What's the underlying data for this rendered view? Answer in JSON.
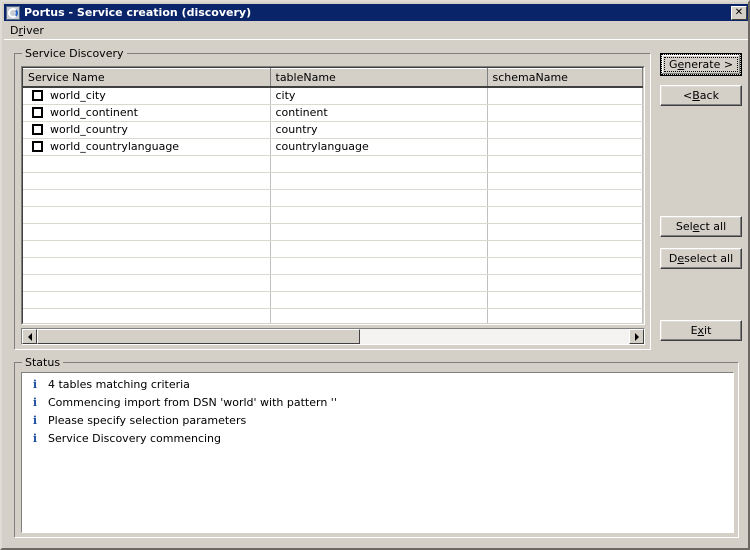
{
  "window": {
    "title": "Portus - Service creation (discovery)",
    "icon": "portus-ring-icon",
    "close_label": "✕"
  },
  "menubar": {
    "items": [
      {
        "label_before": "D",
        "label_accel": "r",
        "label_after": "iver",
        "name": "menu-driver"
      }
    ]
  },
  "discovery": {
    "group_label": "Service Discovery",
    "columns": [
      "Service Name",
      "tableName",
      "schemaName"
    ],
    "rows": [
      {
        "checked": false,
        "service_name": "world_city",
        "table_name": "city",
        "schema_name": ""
      },
      {
        "checked": false,
        "service_name": "world_continent",
        "table_name": "continent",
        "schema_name": ""
      },
      {
        "checked": false,
        "service_name": "world_country",
        "table_name": "country",
        "schema_name": ""
      },
      {
        "checked": false,
        "service_name": "world_countrylanguage",
        "table_name": "countrylanguage",
        "schema_name": ""
      }
    ],
    "empty_row_count": 13,
    "scrollbar": {
      "left_arrow": "scroll-left-icon",
      "right_arrow": "scroll-right-icon",
      "thumb_fraction": 0.545
    }
  },
  "buttons": {
    "generate": {
      "before": "G",
      "accel": "e",
      "after": "nerate >",
      "default": true
    },
    "back": {
      "before": "< ",
      "accel": "B",
      "after": "ack"
    },
    "select_all": {
      "before": "Sel",
      "accel": "e",
      "after": "ct all"
    },
    "deselect_all": {
      "before": "D",
      "accel": "e",
      "after": "select all"
    },
    "exit": {
      "before": "E",
      "accel": "x",
      "after": "it"
    }
  },
  "status": {
    "group_label": "Status",
    "icon": "info-icon",
    "icon_glyph": "i",
    "messages": [
      "4 tables matching criteria",
      "Commencing import from DSN 'world' with pattern ''",
      "Please specify selection parameters",
      "Service Discovery commencing"
    ]
  },
  "colors": {
    "titlebar": "#0a246a",
    "face": "#d4d0c8",
    "info": "#1f4fa0",
    "field": "#ffffff"
  }
}
